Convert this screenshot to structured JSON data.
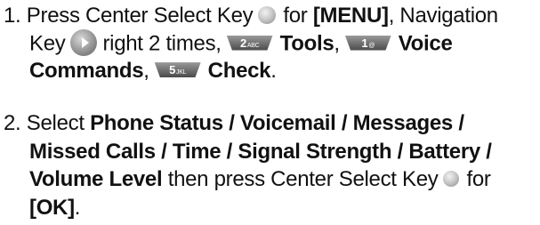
{
  "step1": {
    "number": "1.",
    "press": "Press Center Select Key",
    "for": "for",
    "menu": "[MENU]",
    "after_menu": ", Navigation",
    "key": "Key",
    "right2": "right 2 times,",
    "tools": "Tools",
    "comma": ",",
    "voice": "Voice",
    "commands": "Commands",
    "check": "Check",
    "period": "."
  },
  "step2": {
    "number": "2.",
    "select": "Select",
    "line1_bold": "Phone Status / Voicemail / Messages /",
    "line2_bold": "Missed Calls / Time / Signal Strength / Battery /",
    "volume": "Volume Level",
    "then": "then press Center Select Key",
    "for": "for",
    "ok": "[OK]",
    "period": "."
  },
  "keys": {
    "k2_digit": "2",
    "k2_sub": "ABC",
    "k1_digit": "1",
    "k1_sub": "@",
    "k5_digit": "5",
    "k5_sub": "JKL"
  },
  "icons": {
    "center_select_key": "center-select-key-icon",
    "navigation_key": "navigation-key-right-icon",
    "keypad_key": "keypad-key-icon"
  }
}
